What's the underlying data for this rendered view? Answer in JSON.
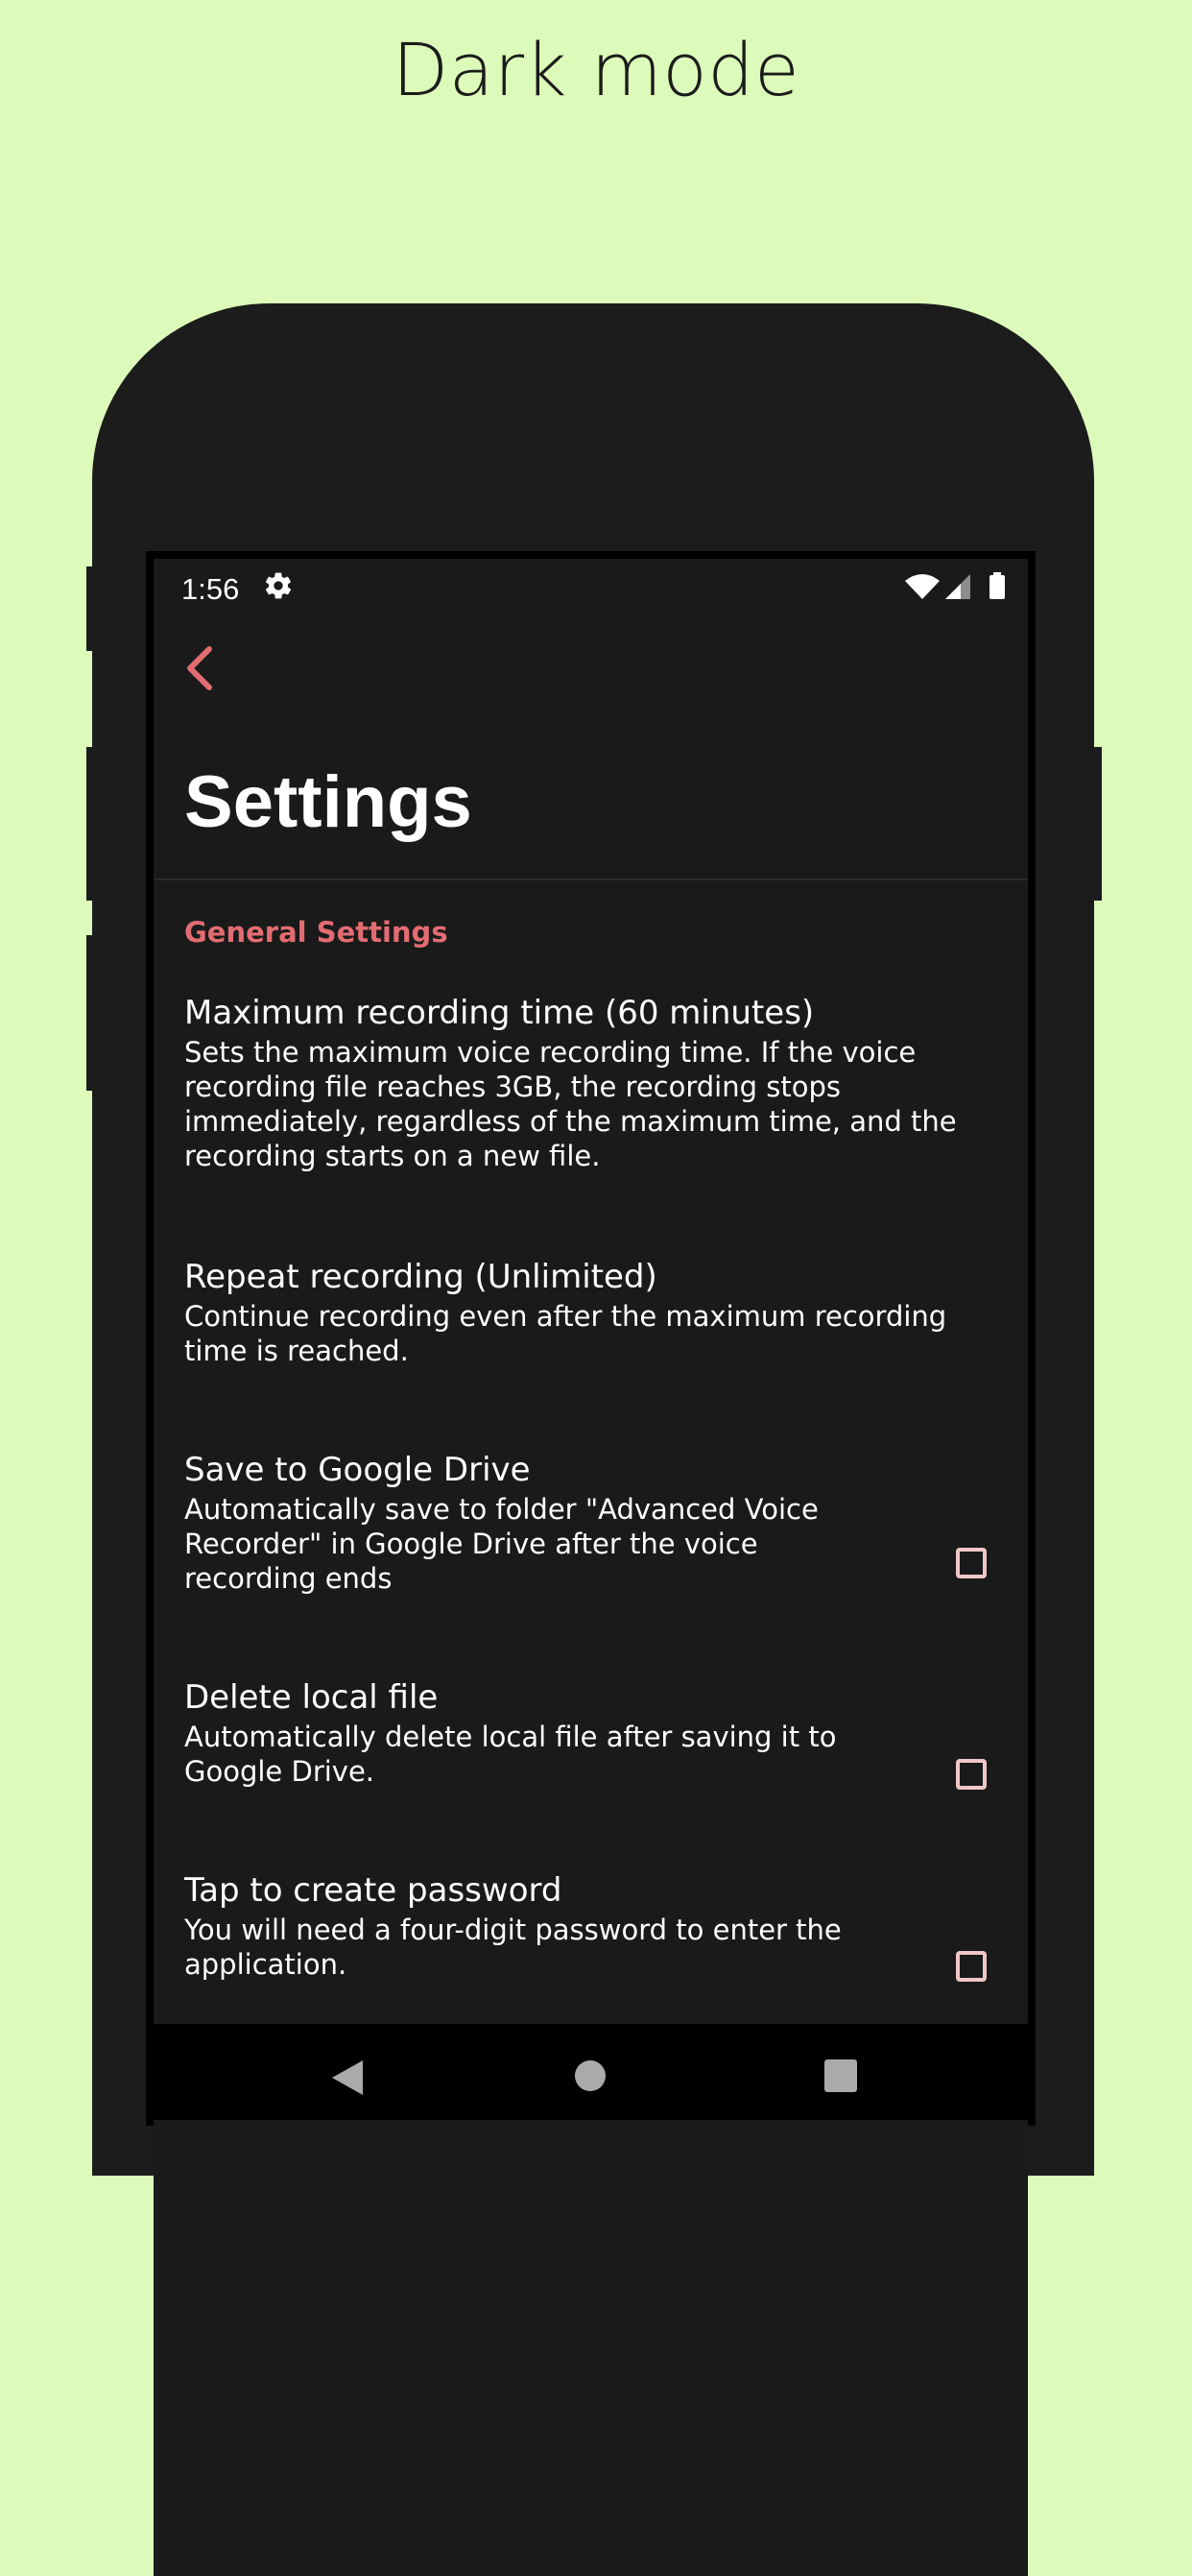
{
  "promo": {
    "headline": "Dark mode"
  },
  "status_bar": {
    "time": "1:56",
    "icons": [
      "gear-icon",
      "wifi-icon",
      "signal-icon",
      "battery-icon"
    ]
  },
  "toolbar": {
    "back_icon": "chevron-left-icon"
  },
  "page": {
    "title": "Settings"
  },
  "colors": {
    "accent": "#e36c72",
    "background": "#1a1a1a",
    "promo_background": "#dcfab9",
    "checkbox_border": "#f2c7c8"
  },
  "general": {
    "header": "General Settings",
    "items": [
      {
        "title": "Maximum recording time (60 minutes)",
        "summary": "Sets the maximum voice recording time. If the voice recording file reaches 3GB, the recording stops immediately, regardless of the maximum time, and the recording starts on a new file."
      },
      {
        "title": "Repeat recording (Unlimited)",
        "summary": "Continue recording even after the maximum recording time is reached."
      },
      {
        "title": "Save to Google Drive",
        "summary": "Automatically save to folder \"Advanced Voice Recorder\" in Google Drive after the voice recording ends",
        "checked": false
      },
      {
        "title": "Delete local file",
        "summary": "Automatically delete local file after saving it to Google Drive.",
        "checked": false
      },
      {
        "title": "Tap to create password",
        "summary": "You will need a four-digit password to enter the application.",
        "checked": false
      }
    ]
  },
  "nav_bar": {
    "icons": [
      "back-triangle-icon",
      "home-circle-icon",
      "recents-square-icon"
    ]
  }
}
